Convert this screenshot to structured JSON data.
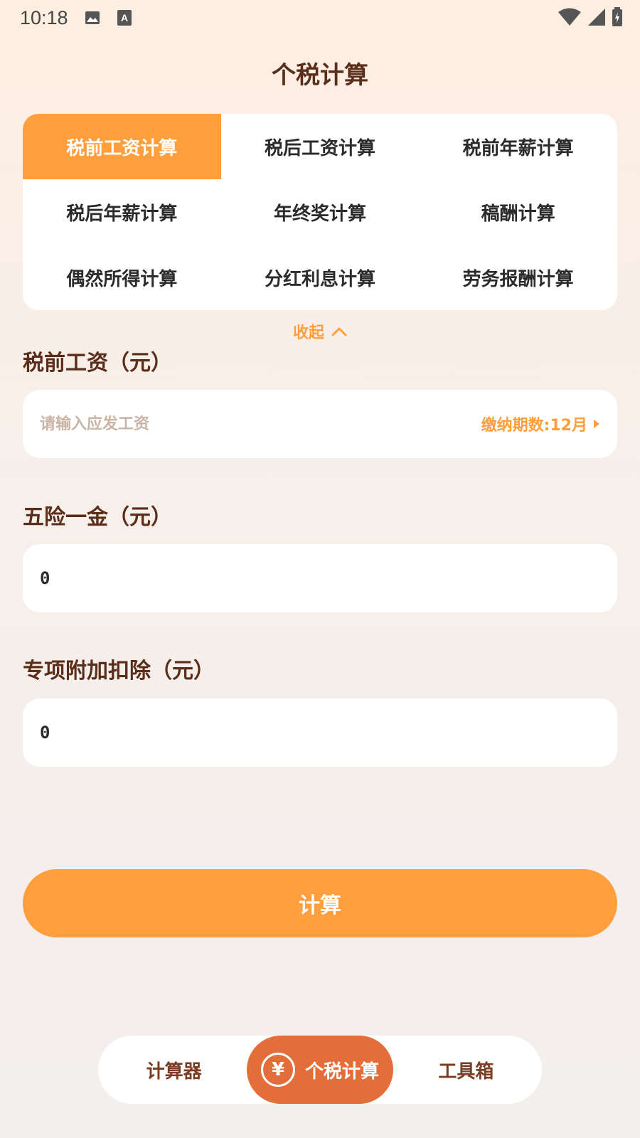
{
  "status_bar": {
    "time": "10:18",
    "icons_left": [
      "image-icon",
      "text-a-icon"
    ],
    "icons_right": [
      "wifi-icon",
      "cellular-signal-icon",
      "battery-charging-icon"
    ]
  },
  "page": {
    "title": "个税计算"
  },
  "tabs": [
    {
      "label": "税前工资计算",
      "active": true
    },
    {
      "label": "税后工资计算",
      "active": false
    },
    {
      "label": "税前年薪计算",
      "active": false
    },
    {
      "label": "税后年薪计算",
      "active": false
    },
    {
      "label": "年终奖计算",
      "active": false
    },
    {
      "label": "稿酬计算",
      "active": false
    },
    {
      "label": "偶然所得计算",
      "active": false
    },
    {
      "label": "分红利息计算",
      "active": false
    },
    {
      "label": "劳务报酬计算",
      "active": false
    }
  ],
  "collapse": {
    "label": "收起",
    "icon": "chevron-up-icon"
  },
  "salary": {
    "label": "税前工资（元）",
    "placeholder": "请输入应发工资",
    "value": "",
    "period_label": "缴纳期数:12月",
    "period_icon": "caret-right-icon"
  },
  "insurance": {
    "label": "五险一金（元）",
    "value": "0"
  },
  "deduction": {
    "label": "专项附加扣除（元）",
    "value": "0"
  },
  "calc_button": {
    "label": "计算"
  },
  "bottom_nav": [
    {
      "label": "计算器",
      "active": false
    },
    {
      "label": "个税计算",
      "active": true,
      "icon": "yen-icon",
      "icon_glyph": "¥"
    },
    {
      "label": "工具箱",
      "active": false
    }
  ],
  "colors": {
    "accent": "#ff9e3d",
    "nav_active": "#e46e3a",
    "text_primary": "#5a2e1a",
    "background_top": "#fdeee2"
  }
}
